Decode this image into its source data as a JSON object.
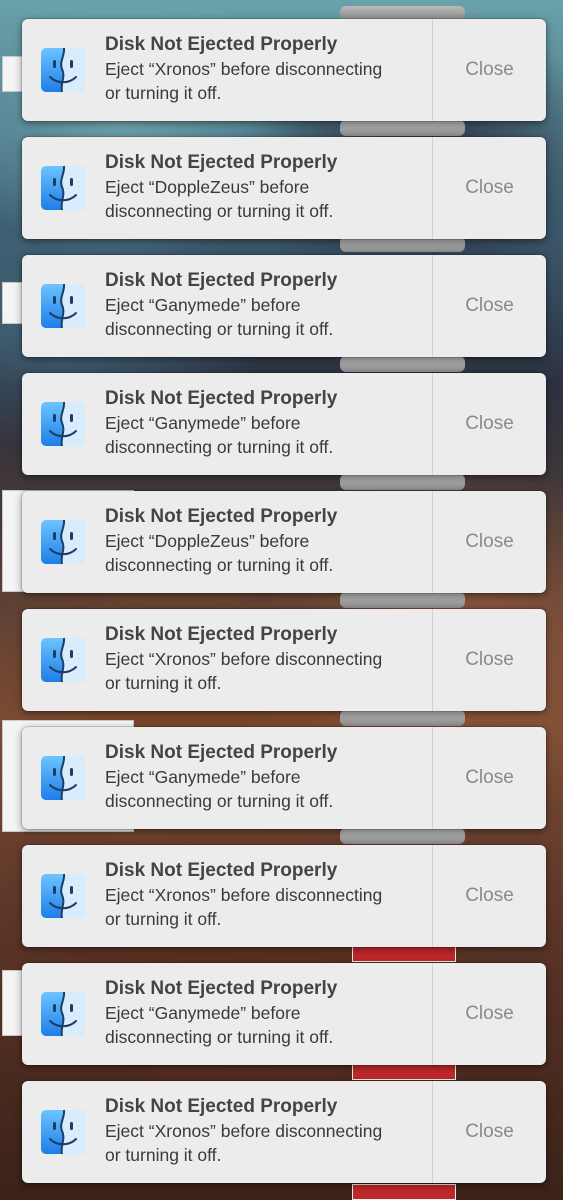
{
  "notifications": [
    {
      "app_icon": "finder-icon",
      "title": "Disk Not Ejected Properly",
      "line1": "Eject “Xronos” before disconnecting",
      "line2": "or turning it off.",
      "close_label": "Close"
    },
    {
      "app_icon": "finder-icon",
      "title": "Disk Not Ejected Properly",
      "line1": "Eject “DoppleZeus” before",
      "line2": "disconnecting or turning it off.",
      "close_label": "Close"
    },
    {
      "app_icon": "finder-icon",
      "title": "Disk Not Ejected Properly",
      "line1": "Eject “Ganymede” before",
      "line2": "disconnecting or turning it off.",
      "close_label": "Close"
    },
    {
      "app_icon": "finder-icon",
      "title": "Disk Not Ejected Properly",
      "line1": "Eject “Ganymede” before",
      "line2": "disconnecting or turning it off.",
      "close_label": "Close"
    },
    {
      "app_icon": "finder-icon",
      "title": "Disk Not Ejected Properly",
      "line1": "Eject “DoppleZeus” before",
      "line2": "disconnecting or turning it off.",
      "close_label": "Close"
    },
    {
      "app_icon": "finder-icon",
      "title": "Disk Not Ejected Properly",
      "line1": "Eject “Xronos” before disconnecting",
      "line2": "or turning it off.",
      "close_label": "Close"
    },
    {
      "app_icon": "finder-icon",
      "title": "Disk Not Ejected Properly",
      "line1": "Eject “Ganymede” before",
      "line2": "disconnecting or turning it off.",
      "close_label": "Close"
    },
    {
      "app_icon": "finder-icon",
      "title": "Disk Not Ejected Properly",
      "line1": "Eject “Xronos” before disconnecting",
      "line2": "or turning it off.",
      "close_label": "Close"
    },
    {
      "app_icon": "finder-icon",
      "title": "Disk Not Ejected Properly",
      "line1": "Eject “Ganymede” before",
      "line2": "disconnecting or turning it off.",
      "close_label": "Close"
    },
    {
      "app_icon": "finder-icon",
      "title": "Disk Not Ejected Properly",
      "line1": "Eject “Xronos” before disconnecting",
      "line2": "or turning it off.",
      "close_label": "Close"
    }
  ],
  "colors": {
    "card_background": "#ececec",
    "title_text": "#444444",
    "message_text": "#3a3a3a",
    "close_text": "#8a8a8a",
    "finder_blue": "#1e8ff0"
  }
}
